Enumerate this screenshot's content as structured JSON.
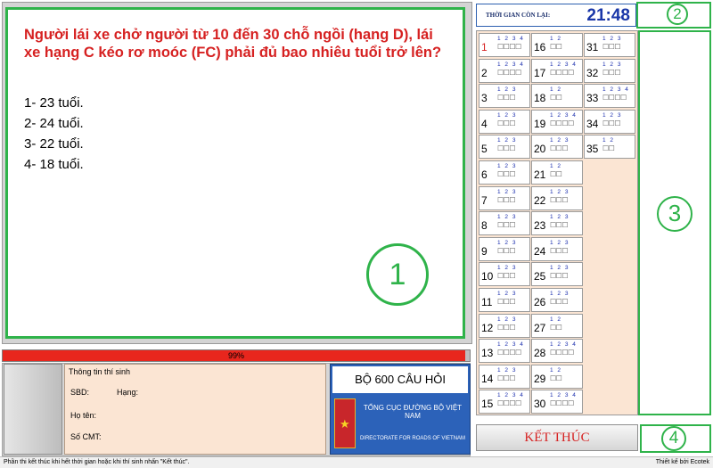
{
  "question": {
    "text": "Người lái xe chở người từ 10 đến 30 chỗ ngồi (hạng D), lái xe hạng C kéo rơ moóc (FC) phải đủ bao nhiêu tuổi trở lên?",
    "answers": [
      "1- 23 tuổi.",
      "2- 24 tuổi.",
      "3- 22 tuổi.",
      "4- 18 tuổi."
    ]
  },
  "annotations": {
    "q": "1",
    "timer": "2",
    "grid": "3",
    "finish": "4"
  },
  "progress": {
    "label": "99%",
    "value": 99
  },
  "candidate": {
    "title": "Thông tin thí sinh",
    "sbd_label": "SBD:",
    "hang_label": "Hạng:",
    "name_label": "Họ tên:",
    "cmt_label": "Số CMT:"
  },
  "branding": {
    "title": "BỘ 600 CÂU HỎI",
    "org_vi": "TỔNG CỤC ĐƯỜNG BỘ VIỆT NAM",
    "org_en": "DIRECTORATE FOR ROADS OF VIETNAM"
  },
  "timer": {
    "label": "THỜI GIAN CÒN LẠI:",
    "value": "21:48"
  },
  "finish_label": "KẾT THÚC",
  "status": {
    "left": "Phần thi kết thúc khi hết thời gian hoặc khi thí sinh nhấn \"Kết thúc\".",
    "right": "Thiết kế bởi Ecotek"
  },
  "questions_grid": [
    {
      "n": "1",
      "opts": 4,
      "current": true
    },
    {
      "n": "2",
      "opts": 4
    },
    {
      "n": "3",
      "opts": 3
    },
    {
      "n": "4",
      "opts": 3
    },
    {
      "n": "5",
      "opts": 3
    },
    {
      "n": "6",
      "opts": 3
    },
    {
      "n": "7",
      "opts": 3
    },
    {
      "n": "8",
      "opts": 3
    },
    {
      "n": "9",
      "opts": 3
    },
    {
      "n": "10",
      "opts": 3
    },
    {
      "n": "11",
      "opts": 3
    },
    {
      "n": "12",
      "opts": 3
    },
    {
      "n": "13",
      "opts": 4
    },
    {
      "n": "14",
      "opts": 3
    },
    {
      "n": "15",
      "opts": 4
    },
    {
      "n": "16",
      "opts": 2
    },
    {
      "n": "17",
      "opts": 4
    },
    {
      "n": "18",
      "opts": 2
    },
    {
      "n": "19",
      "opts": 4
    },
    {
      "n": "20",
      "opts": 3
    },
    {
      "n": "21",
      "opts": 2
    },
    {
      "n": "22",
      "opts": 3
    },
    {
      "n": "23",
      "opts": 3
    },
    {
      "n": "24",
      "opts": 3
    },
    {
      "n": "25",
      "opts": 3
    },
    {
      "n": "26",
      "opts": 3
    },
    {
      "n": "27",
      "opts": 2
    },
    {
      "n": "28",
      "opts": 4
    },
    {
      "n": "29",
      "opts": 2
    },
    {
      "n": "30",
      "opts": 4
    },
    {
      "n": "31",
      "opts": 3
    },
    {
      "n": "32",
      "opts": 3
    },
    {
      "n": "33",
      "opts": 4
    },
    {
      "n": "34",
      "opts": 3
    },
    {
      "n": "35",
      "opts": 2
    }
  ]
}
